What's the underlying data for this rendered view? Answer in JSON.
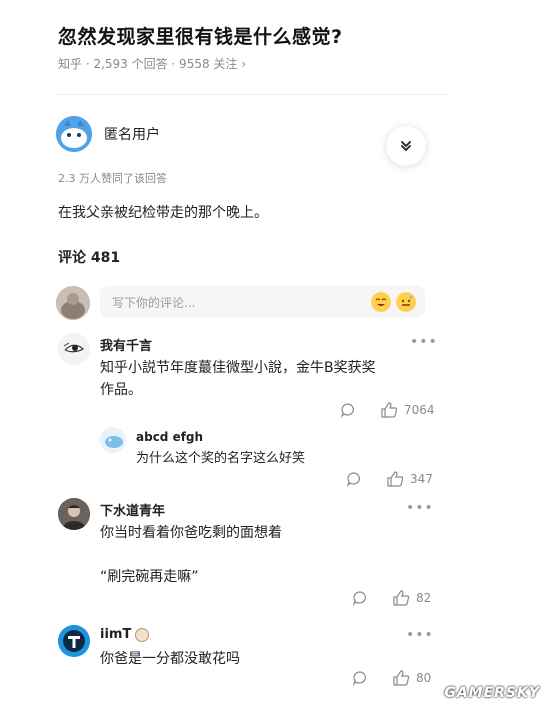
{
  "question": {
    "title": "忽然发现家里很有钱是什么感觉?",
    "meta": "知乎 · 2,593 个回答 · 9558 关注 ›"
  },
  "answer": {
    "author": "匿名用户",
    "upvote_note": "2.3 万人赞同了该回答",
    "text": "在我父亲被纪检带走的那个晚上。"
  },
  "comments": {
    "header": "评论 481",
    "input_placeholder": "写下你的评论...",
    "items": [
      {
        "name": "我有千言",
        "text_line1": "知乎小説节年度蕞佳微型小說，金牛B奖获奖",
        "text_line2": "作品。",
        "likes": "7064",
        "reply": {
          "name": "abcd efgh",
          "text": "为什么这个奖的名字这么好笑",
          "likes": "347"
        }
      },
      {
        "name": "下水道青年",
        "text_line1": "你当时看着你爸吃剩的面想着",
        "text_line2": "“刷完碗再走嘛”",
        "likes": "82"
      },
      {
        "name": "iimT",
        "text_line1": "你爸是一分都没敢花吗",
        "likes": "80"
      }
    ]
  },
  "watermark": "GAMERSKY",
  "colors": {
    "accent_blue": "#4fa3e6",
    "text_gray": "#8a8a8a"
  }
}
